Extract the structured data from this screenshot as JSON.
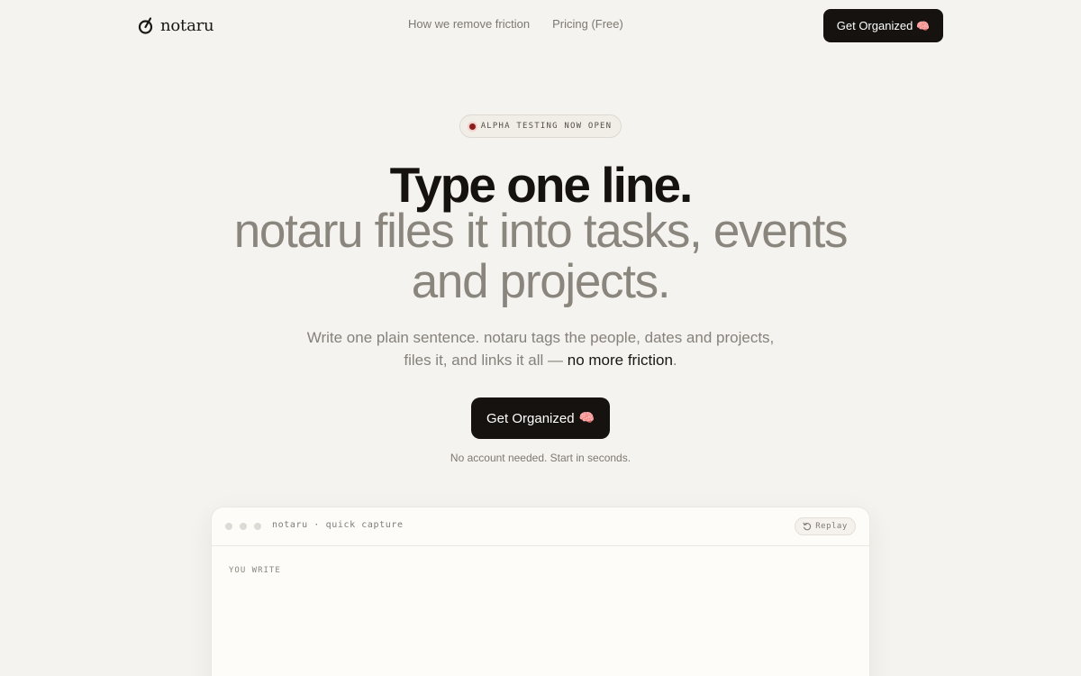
{
  "nav": {
    "brand": "notaru",
    "links": [
      "How we remove friction",
      "Pricing (Free)"
    ],
    "cta_label": "Get Organized",
    "cta_emoji": "🧠"
  },
  "hero": {
    "badge": "ALPHA TESTING NOW OPEN",
    "headline": "Type one line.",
    "subheadline_line1": "notaru files it into tasks, events",
    "subheadline_line2": "and projects.",
    "lede_line1": "Write one plain sentence. notaru tags the people, dates and projects,",
    "lede_line2_start": "files it, and links it all — ",
    "lede_emphasis": "no more friction",
    "lede_end": ".",
    "cta_label": "Get Organized",
    "cta_emoji": "🧠",
    "note": "No account needed. Start in seconds."
  },
  "card": {
    "title": "notaru · quick capture",
    "replay_label": "Replay",
    "section_label": "YOU WRITE"
  },
  "colors": {
    "background": "#f5f3ef",
    "primary_button": "#15120f",
    "accent_dot": "#8a1c1c"
  }
}
